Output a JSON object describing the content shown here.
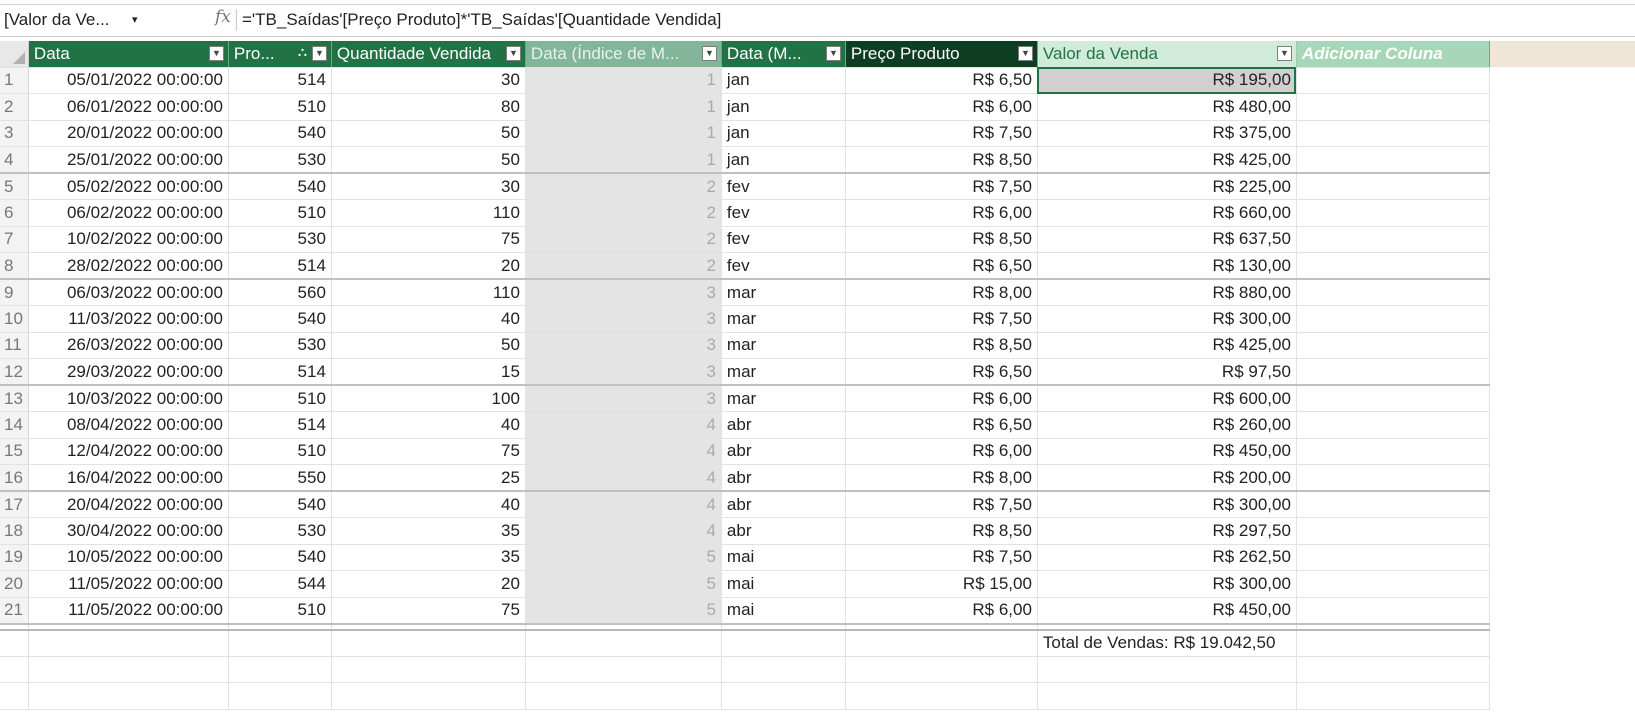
{
  "formula_bar": {
    "name_box": "[Valor da Ve...",
    "name_box_arrow": "▾",
    "fx_label": "fx",
    "formula": "='TB_Saídas'[Preço Produto]*'TB_Saídas'[Quantidade Vendida]"
  },
  "columns": [
    {
      "label": "Data"
    },
    {
      "label": "Pro..."
    },
    {
      "label": "Quantidade Vendida"
    },
    {
      "label": "Data (Índice de M..."
    },
    {
      "label": "Data (M..."
    },
    {
      "label": "Preço Produto"
    },
    {
      "label": "Valor da Venda"
    },
    {
      "label": "Adicionar Coluna"
    }
  ],
  "rows": [
    {
      "n": "1",
      "data": "05/01/2022 00:00:00",
      "prod": "514",
      "qtd": "30",
      "idx": "1",
      "mes": "jan",
      "preco": "R$ 6,50",
      "valor": "R$ 195,00"
    },
    {
      "n": "2",
      "data": "06/01/2022 00:00:00",
      "prod": "510",
      "qtd": "80",
      "idx": "1",
      "mes": "jan",
      "preco": "R$ 6,00",
      "valor": "R$ 480,00"
    },
    {
      "n": "3",
      "data": "20/01/2022 00:00:00",
      "prod": "540",
      "qtd": "50",
      "idx": "1",
      "mes": "jan",
      "preco": "R$ 7,50",
      "valor": "R$ 375,00"
    },
    {
      "n": "4",
      "data": "25/01/2022 00:00:00",
      "prod": "530",
      "qtd": "50",
      "idx": "1",
      "mes": "jan",
      "preco": "R$ 8,50",
      "valor": "R$ 425,00"
    },
    {
      "n": "5",
      "data": "05/02/2022 00:00:00",
      "prod": "540",
      "qtd": "30",
      "idx": "2",
      "mes": "fev",
      "preco": "R$ 7,50",
      "valor": "R$ 225,00"
    },
    {
      "n": "6",
      "data": "06/02/2022 00:00:00",
      "prod": "510",
      "qtd": "110",
      "idx": "2",
      "mes": "fev",
      "preco": "R$ 6,00",
      "valor": "R$ 660,00"
    },
    {
      "n": "7",
      "data": "10/02/2022 00:00:00",
      "prod": "530",
      "qtd": "75",
      "idx": "2",
      "mes": "fev",
      "preco": "R$ 8,50",
      "valor": "R$ 637,50"
    },
    {
      "n": "8",
      "data": "28/02/2022 00:00:00",
      "prod": "514",
      "qtd": "20",
      "idx": "2",
      "mes": "fev",
      "preco": "R$ 6,50",
      "valor": "R$ 130,00"
    },
    {
      "n": "9",
      "data": "06/03/2022 00:00:00",
      "prod": "560",
      "qtd": "110",
      "idx": "3",
      "mes": "mar",
      "preco": "R$ 8,00",
      "valor": "R$ 880,00"
    },
    {
      "n": "10",
      "data": "11/03/2022 00:00:00",
      "prod": "540",
      "qtd": "40",
      "idx": "3",
      "mes": "mar",
      "preco": "R$ 7,50",
      "valor": "R$ 300,00"
    },
    {
      "n": "11",
      "data": "26/03/2022 00:00:00",
      "prod": "530",
      "qtd": "50",
      "idx": "3",
      "mes": "mar",
      "preco": "R$ 8,50",
      "valor": "R$ 425,00"
    },
    {
      "n": "12",
      "data": "29/03/2022 00:00:00",
      "prod": "514",
      "qtd": "15",
      "idx": "3",
      "mes": "mar",
      "preco": "R$ 6,50",
      "valor": "R$ 97,50"
    },
    {
      "n": "13",
      "data": "10/03/2022 00:00:00",
      "prod": "510",
      "qtd": "100",
      "idx": "3",
      "mes": "mar",
      "preco": "R$ 6,00",
      "valor": "R$ 600,00"
    },
    {
      "n": "14",
      "data": "08/04/2022 00:00:00",
      "prod": "514",
      "qtd": "40",
      "idx": "4",
      "mes": "abr",
      "preco": "R$ 6,50",
      "valor": "R$ 260,00"
    },
    {
      "n": "15",
      "data": "12/04/2022 00:00:00",
      "prod": "510",
      "qtd": "75",
      "idx": "4",
      "mes": "abr",
      "preco": "R$ 6,00",
      "valor": "R$ 450,00"
    },
    {
      "n": "16",
      "data": "16/04/2022 00:00:00",
      "prod": "550",
      "qtd": "25",
      "idx": "4",
      "mes": "abr",
      "preco": "R$ 8,00",
      "valor": "R$ 200,00"
    },
    {
      "n": "17",
      "data": "20/04/2022 00:00:00",
      "prod": "540",
      "qtd": "40",
      "idx": "4",
      "mes": "abr",
      "preco": "R$ 7,50",
      "valor": "R$ 300,00"
    },
    {
      "n": "18",
      "data": "30/04/2022 00:00:00",
      "prod": "530",
      "qtd": "35",
      "idx": "4",
      "mes": "abr",
      "preco": "R$ 8,50",
      "valor": "R$ 297,50"
    },
    {
      "n": "19",
      "data": "10/05/2022 00:00:00",
      "prod": "540",
      "qtd": "35",
      "idx": "5",
      "mes": "mai",
      "preco": "R$ 7,50",
      "valor": "R$ 262,50"
    },
    {
      "n": "20",
      "data": "11/05/2022 00:00:00",
      "prod": "544",
      "qtd": "20",
      "idx": "5",
      "mes": "mai",
      "preco": "R$ 15,00",
      "valor": "R$ 300,00"
    },
    {
      "n": "21",
      "data": "11/05/2022 00:00:00",
      "prod": "510",
      "qtd": "75",
      "idx": "5",
      "mes": "mai",
      "preco": "R$ 6,00",
      "valor": "R$ 450,00"
    }
  ],
  "measures": {
    "total_vendas": "Total de Vendas: R$ 19.042,50"
  },
  "colors": {
    "header_green": "#217346",
    "header_dark": "#0f3d23",
    "header_light": "#d1ebda",
    "selection_border": "#217346"
  }
}
